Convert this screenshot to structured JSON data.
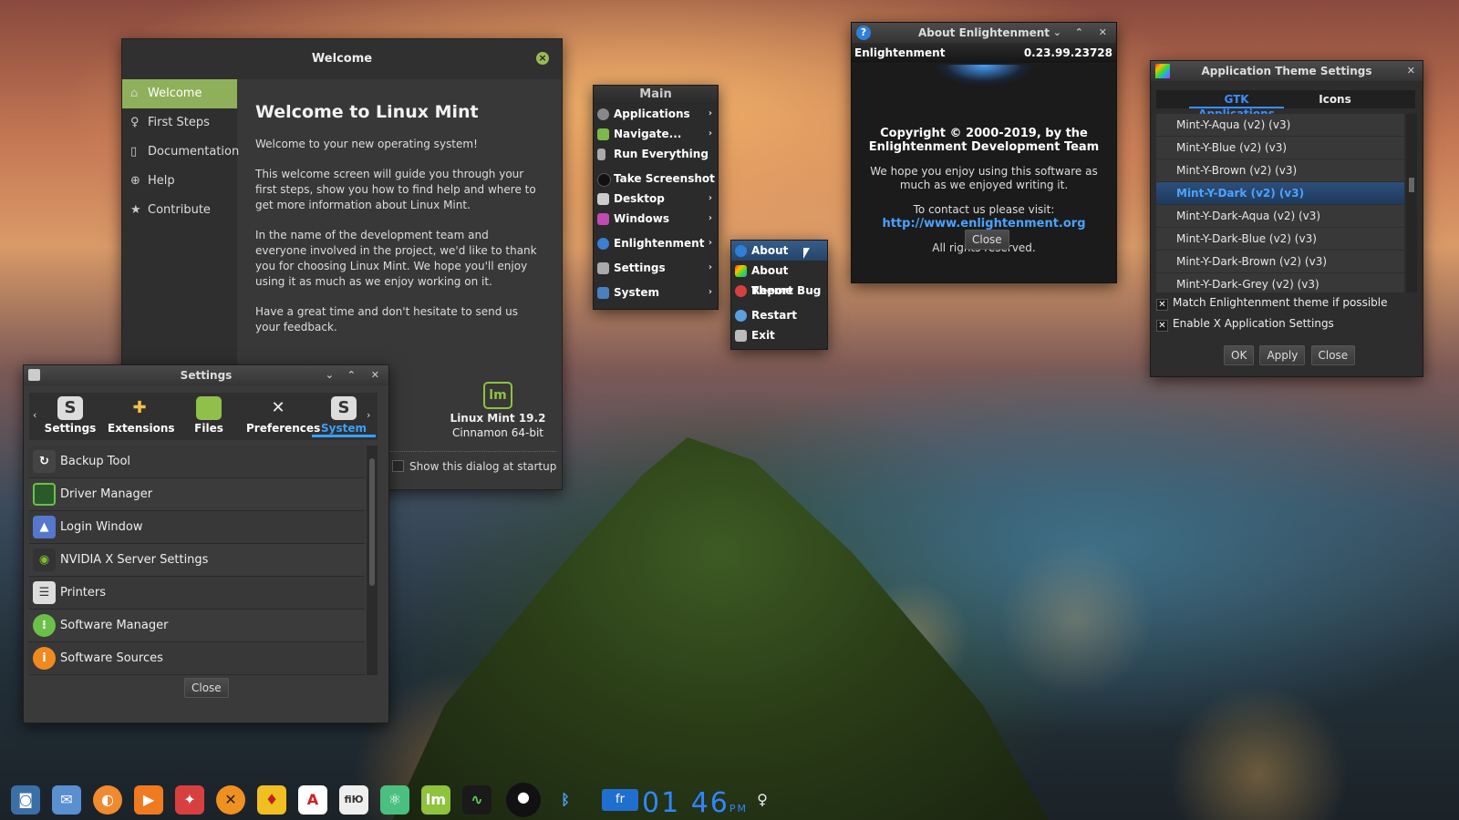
{
  "welcome": {
    "title": "Welcome",
    "sidebar": [
      {
        "label": "Welcome",
        "icon": "home-icon"
      },
      {
        "label": "First Steps",
        "icon": "lightbulb-icon"
      },
      {
        "label": "Documentation",
        "icon": "book-icon"
      },
      {
        "label": "Help",
        "icon": "lifebuoy-icon"
      },
      {
        "label": "Contribute",
        "icon": "star-icon"
      }
    ],
    "heading": "Welcome to Linux Mint",
    "p1": "Welcome to your new operating system!",
    "p2": "This welcome screen will guide you through your first steps, show you how to find help and where to get more information about Linux Mint.",
    "p3": "In the name of the development team and everyone involved in the project, we'd like to thank you for choosing Linux Mint. We hope you'll enjoy using it as much as we enjoy working on it.",
    "p4": "Have a great time and don't hesitate to send us your feedback.",
    "version_line1": "Linux Mint 19.2",
    "version_line2": "Cinnamon 64-bit",
    "startup_label": "Show this dialog at startup",
    "accent": "#8fb05a"
  },
  "settings": {
    "title": "Settings",
    "categories": [
      {
        "label": "Settings"
      },
      {
        "label": "Extensions"
      },
      {
        "label": "Files"
      },
      {
        "label": "Preferences"
      },
      {
        "label": "System",
        "active": true
      }
    ],
    "items": [
      {
        "label": "Backup Tool"
      },
      {
        "label": "Driver Manager"
      },
      {
        "label": "Login Window"
      },
      {
        "label": "NVIDIA X Server Settings"
      },
      {
        "label": "Printers"
      },
      {
        "label": "Software Manager"
      },
      {
        "label": "Software Sources"
      }
    ],
    "close_label": "Close"
  },
  "main_menu": {
    "title": "Main",
    "items": [
      {
        "label": "Applications"
      },
      {
        "label": "Navigate..."
      },
      {
        "label": "Run Everything"
      },
      {
        "label": "Take Screenshot"
      },
      {
        "label": "Desktop"
      },
      {
        "label": "Windows"
      },
      {
        "label": "Enlightenment"
      },
      {
        "label": "Settings"
      },
      {
        "label": "System"
      }
    ]
  },
  "submenu": {
    "items": [
      {
        "label": "About"
      },
      {
        "label": "About Theme"
      },
      {
        "label": "Report Bug"
      },
      {
        "label": "Restart"
      },
      {
        "label": "Exit"
      }
    ]
  },
  "about": {
    "title": "About Enlightenment",
    "app_name": "Enlightenment",
    "version": "0.23.99.23728",
    "copyright_line1": "Copyright © 2000-2019, by the",
    "copyright_line2": "Enlightenment Development Team",
    "hope_line1": "We hope you enjoy using this software as",
    "hope_line2": "much as we enjoyed writing it.",
    "contact": "To contact us please visit:",
    "url": "http://www.enlightenment.org",
    "rights": "All rights reserved.",
    "close_label": "Close"
  },
  "theme": {
    "title": "Application Theme Settings",
    "tabs": [
      {
        "label": "GTK Applications"
      },
      {
        "label": "Icons"
      }
    ],
    "themes": [
      {
        "label": "Mint-Y-Aqua (v2) (v3)"
      },
      {
        "label": "Mint-Y-Blue (v2) (v3)"
      },
      {
        "label": "Mint-Y-Brown (v2) (v3)"
      },
      {
        "label": "Mint-Y-Dark (v2) (v3)"
      },
      {
        "label": "Mint-Y-Dark-Aqua (v2) (v3)"
      },
      {
        "label": "Mint-Y-Dark-Blue (v2) (v3)"
      },
      {
        "label": "Mint-Y-Dark-Brown (v2) (v3)"
      },
      {
        "label": "Mint-Y-Dark-Grey (v2) (v3)"
      }
    ],
    "selected_index": 3,
    "match_label": "Match Enlightenment theme if possible",
    "enable_label": "Enable X Application Settings",
    "ok_label": "OK",
    "apply_label": "Apply",
    "close_label": "Close"
  },
  "dock": {
    "lang": "fr",
    "clock": "01 46",
    "ampm": "PM"
  }
}
